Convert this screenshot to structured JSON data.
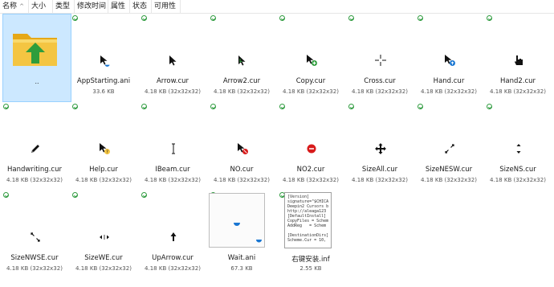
{
  "header": {
    "columns": [
      {
        "label": "名称"
      },
      {
        "label": "大小"
      },
      {
        "label": "类型"
      },
      {
        "label": "修改时间"
      },
      {
        "label": "属性"
      },
      {
        "label": "状态"
      },
      {
        "label": "可用性"
      }
    ],
    "sort_icon": "sort-up-icon"
  },
  "files": {
    "parent": {
      "name": ".."
    },
    "items": [
      {
        "name": "AppStarting.ani",
        "meta": "33.6 KB",
        "icon": "app-starting-cursor-icon"
      },
      {
        "name": "Arrow.cur",
        "meta": "4.18 KB (32x32x32)",
        "icon": "arrow-cursor-icon"
      },
      {
        "name": "Arrow2.cur",
        "meta": "4.18 KB (32x32x32)",
        "icon": "arrow2-cursor-icon"
      },
      {
        "name": "Copy.cur",
        "meta": "4.18 KB (32x32x32)",
        "icon": "copy-cursor-icon"
      },
      {
        "name": "Cross.cur",
        "meta": "4.18 KB (32x32x32)",
        "icon": "cross-cursor-icon"
      },
      {
        "name": "Hand.cur",
        "meta": "4.18 KB (32x32x32)",
        "icon": "hand-cursor-icon"
      },
      {
        "name": "Hand2.cur",
        "meta": "4.18 KB (32x32x32)",
        "icon": "hand2-cursor-icon"
      },
      {
        "name": "Handwriting.cur",
        "meta": "4.18 KB (32x32x32)",
        "icon": "pen-cursor-icon"
      },
      {
        "name": "Help.cur",
        "meta": "4.18 KB (32x32x32)",
        "icon": "help-cursor-icon"
      },
      {
        "name": "IBeam.cur",
        "meta": "4.18 KB (32x32x32)",
        "icon": "ibeam-cursor-icon"
      },
      {
        "name": "NO.cur",
        "meta": "4.18 KB (32x32x32)",
        "icon": "no-cursor-icon"
      },
      {
        "name": "NO2.cur",
        "meta": "4.18 KB (32x32x32)",
        "icon": "no2-cursor-icon"
      },
      {
        "name": "SizeAll.cur",
        "meta": "4.18 KB (32x32x32)",
        "icon": "size-all-cursor-icon"
      },
      {
        "name": "SizeNESW.cur",
        "meta": "4.18 KB (32x32x32)",
        "icon": "size-nesw-cursor-icon"
      },
      {
        "name": "SizeNS.cur",
        "meta": "4.18 KB (32x32x32)",
        "icon": "size-ns-cursor-icon"
      },
      {
        "name": "SizeNWSE.cur",
        "meta": "4.18 KB (32x32x32)",
        "icon": "size-nwse-cursor-icon"
      },
      {
        "name": "SizeWE.cur",
        "meta": "4.18 KB (32x32x32)",
        "icon": "size-we-cursor-icon"
      },
      {
        "name": "UpArrow.cur",
        "meta": "4.18 KB (32x32x32)",
        "icon": "up-arrow-cursor-icon"
      },
      {
        "name": "Wait.ani",
        "meta": "67.3 KB",
        "icon": "wait-cursor-preview-icon"
      },
      {
        "name": "右键安装.inf",
        "meta": "2.55 KB",
        "icon": "inf-document-preview-icon"
      }
    ]
  },
  "inf_preview_text": "[Version]\nsignature=\"$CHICA\nDeepin2 Cursors b\nhttp://aleaga123\n[DefaultInstall]\nCopyFiles = Schem\nAddReg   = Schem\n\n[DestinationDirs]\nScheme.Cur = 10,",
  "colors": {
    "accent_blue": "#1976d2",
    "status_green": "#2f9b3f",
    "no_red": "#d81b1b",
    "folder_yellow": "#f4c542",
    "selection": "#cce8ff"
  }
}
